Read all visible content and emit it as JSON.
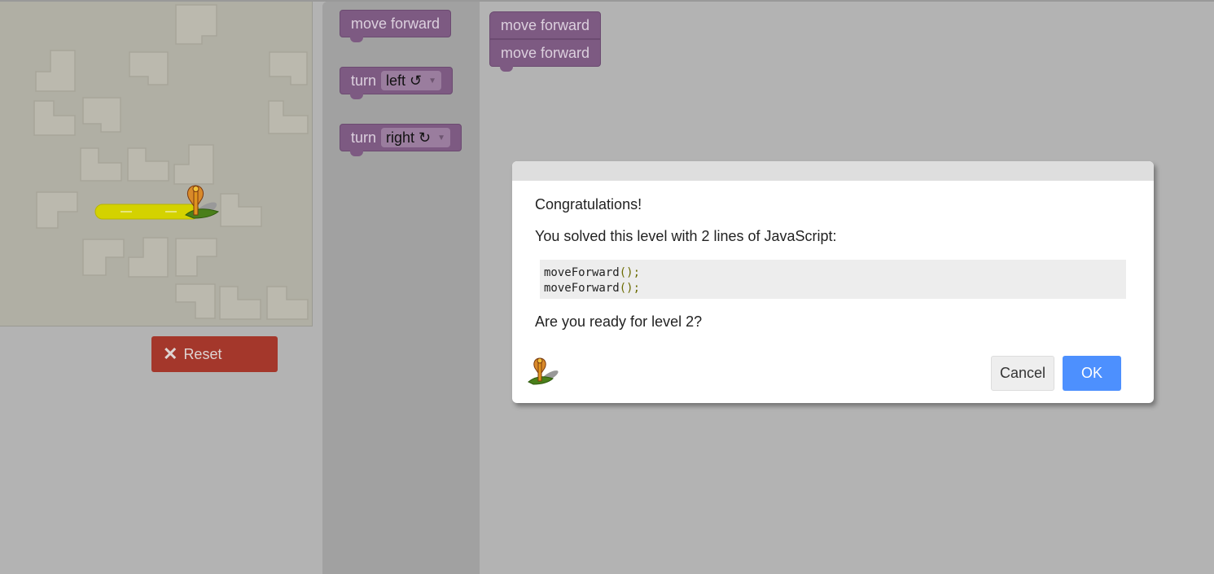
{
  "toolbox": {
    "move_forward_label": "move forward",
    "turn_left": {
      "label": "turn",
      "value": "left ↺"
    },
    "turn_right": {
      "label": "turn",
      "value": "right ↻"
    }
  },
  "workspace": {
    "blocks": [
      "move forward",
      "move forward"
    ]
  },
  "controls": {
    "reset_label": "Reset",
    "reset_icon": "close-icon"
  },
  "dialog": {
    "title": "Congratulations!",
    "solved_text": "You solved this level with 2 lines of JavaScript:",
    "code": [
      {
        "fn": "moveForward",
        "punct": "();"
      },
      {
        "fn": "moveForward",
        "punct": "();"
      }
    ],
    "next_text": "Are you ready for level 2?",
    "cancel_label": "Cancel",
    "ok_label": "OK"
  },
  "colors": {
    "block_purple": "#7d5a82",
    "reset_red": "#a4372b",
    "ok_blue": "#4d90fe",
    "path_yellow": "#d4d200"
  }
}
